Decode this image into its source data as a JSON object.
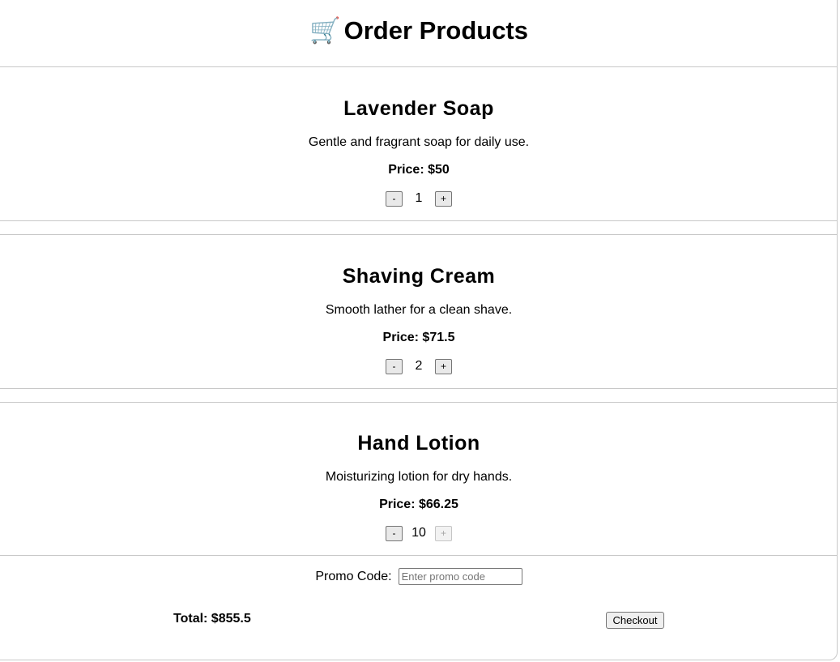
{
  "header": {
    "icon": "🛒",
    "title": "Order Products"
  },
  "products": [
    {
      "name": "Lavender Soap",
      "description": "Gentle and fragrant soap for daily use.",
      "price_label": "Price: $50",
      "decrement_label": "-",
      "quantity": "1",
      "increment_label": "+",
      "increment_disabled": false
    },
    {
      "name": "Shaving Cream",
      "description": "Smooth lather for a clean shave.",
      "price_label": "Price: $71.5",
      "decrement_label": "-",
      "quantity": "2",
      "increment_label": "+",
      "increment_disabled": false
    },
    {
      "name": "Hand Lotion",
      "description": "Moisturizing lotion for dry hands.",
      "price_label": "Price: $66.25",
      "decrement_label": "-",
      "quantity": "10",
      "increment_label": "+",
      "increment_disabled": true
    }
  ],
  "promo": {
    "label": "Promo Code:",
    "value": "",
    "placeholder": "Enter promo code"
  },
  "summary": {
    "total_label": "Total: $855.5",
    "checkout_label": "Checkout"
  }
}
